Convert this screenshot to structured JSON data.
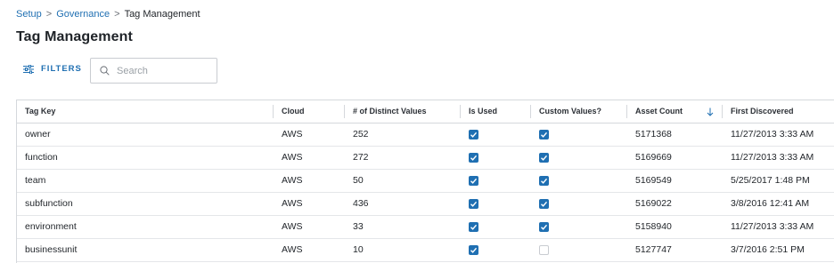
{
  "breadcrumb": {
    "items": [
      "Setup",
      "Governance"
    ],
    "separator": ">",
    "current": "Tag Management"
  },
  "page": {
    "title": "Tag Management"
  },
  "toolbar": {
    "filters_label": "FILTERS",
    "search_placeholder": "Search",
    "search_value": ""
  },
  "table": {
    "headers": [
      "Tag Key",
      "Cloud",
      "# of Distinct Values",
      "Is Used",
      "Custom Values?",
      "Asset Count",
      "First Discovered"
    ],
    "sort": {
      "column": "Asset Count",
      "direction": "descending"
    },
    "rows": [
      {
        "tag_key": "owner",
        "cloud": "AWS",
        "distinct": "252",
        "is_used": true,
        "custom": true,
        "asset_count": "5171368",
        "first_discovered": "11/27/2013 3:33 AM"
      },
      {
        "tag_key": "function",
        "cloud": "AWS",
        "distinct": "272",
        "is_used": true,
        "custom": true,
        "asset_count": "5169669",
        "first_discovered": "11/27/2013 3:33 AM"
      },
      {
        "tag_key": "team",
        "cloud": "AWS",
        "distinct": "50",
        "is_used": true,
        "custom": true,
        "asset_count": "5169549",
        "first_discovered": "5/25/2017 1:48 PM"
      },
      {
        "tag_key": "subfunction",
        "cloud": "AWS",
        "distinct": "436",
        "is_used": true,
        "custom": true,
        "asset_count": "5169022",
        "first_discovered": "3/8/2016 12:41 AM"
      },
      {
        "tag_key": "environment",
        "cloud": "AWS",
        "distinct": "33",
        "is_used": true,
        "custom": true,
        "asset_count": "5158940",
        "first_discovered": "11/27/2013 3:33 AM"
      },
      {
        "tag_key": "businessunit",
        "cloud": "AWS",
        "distinct": "10",
        "is_used": true,
        "custom": false,
        "asset_count": "5127747",
        "first_discovered": "3/7/2016 2:51 PM"
      }
    ]
  },
  "colors": {
    "accent": "#1f6fb2",
    "border": "#d5d8dc"
  }
}
